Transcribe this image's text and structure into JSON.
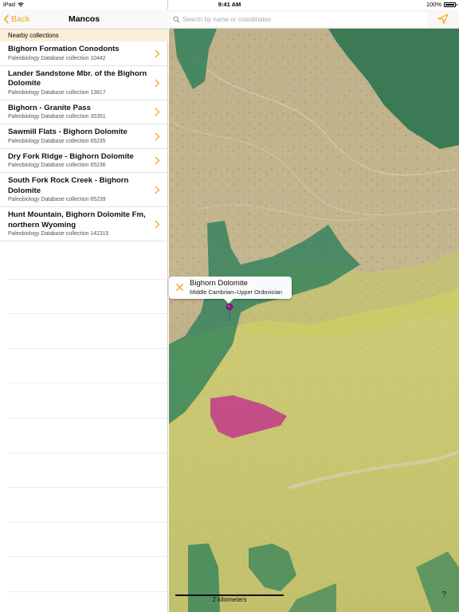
{
  "status_bar": {
    "carrier": "iPad",
    "time": "9:41 AM",
    "battery": "100%",
    "battery_level": 1.0
  },
  "sidebar": {
    "back_label": "Back",
    "title": "Mancos",
    "section_header": "Nearby collections",
    "items": [
      {
        "title": "Bighorn Formation Conodonts",
        "subtitle": "Paleobiology Database collection 10442"
      },
      {
        "title": "Lander Sandstone Mbr. of the Bighorn Dolomite",
        "subtitle": "Paleobiology Database collection 13817"
      },
      {
        "title": "Bighorn - Granite Pass",
        "subtitle": "Paleobiology Database collection 35351"
      },
      {
        "title": "Sawmill Flats - Bighorn Dolomite",
        "subtitle": "Paleobiology Database collection 65235"
      },
      {
        "title": "Dry Fork Ridge - Bighorn Dolomite",
        "subtitle": "Paleobiology Database collection 65236"
      },
      {
        "title": "South Fork Rock Creek - Bighorn Dolomite",
        "subtitle": "Paleobiology Database collection 65239"
      },
      {
        "title": "Hunt Mountain, Bighorn Dolomite Fm, northern Wyoming",
        "subtitle": "Paleobiology Database collection 142315"
      }
    ]
  },
  "map": {
    "search_placeholder": "Search by name or coordinates",
    "callout": {
      "title": "Bighorn Dolomite",
      "subtitle": "Middle Cambrian–Upper Ordovician"
    },
    "scale_label": "2 kilometers",
    "info_label": "?",
    "colors": {
      "accent": "#f5a623",
      "unit_green": "#1e7a5a",
      "unit_yellow": "#d9e26a",
      "unit_magenta": "#c2338a",
      "pin": "#8a1a8a"
    }
  }
}
